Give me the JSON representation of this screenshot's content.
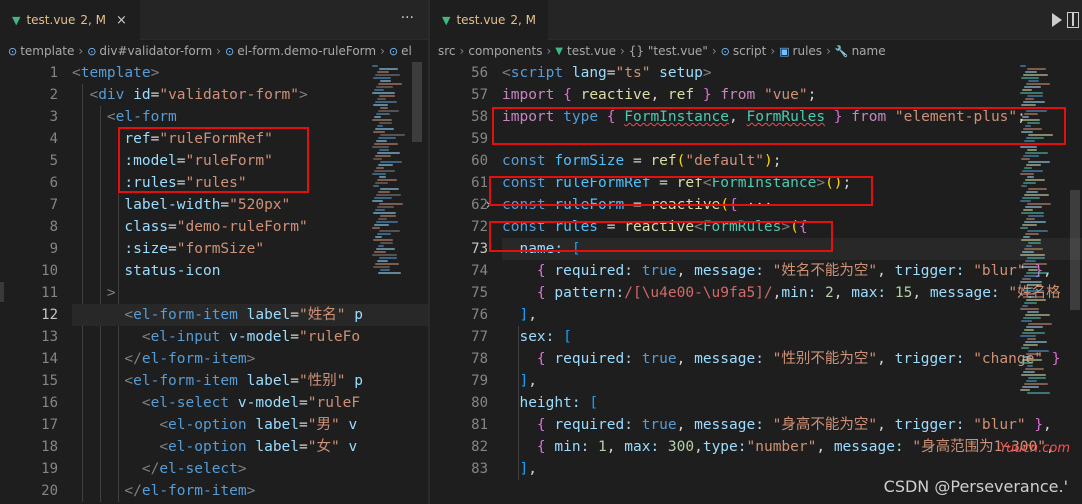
{
  "colors": {
    "vue": "#41b883",
    "modified": "#e2c08d",
    "highlight_box": "#e41010",
    "background": "#1e1e1e"
  },
  "left_editor": {
    "tab": {
      "icon": "vue-icon",
      "filename": "test.vue",
      "status": "2, M",
      "close": "×"
    },
    "more_actions": "···",
    "breadcrumb": [
      "template",
      "div#validator-form",
      "el-form.demo-ruleForm",
      "el"
    ],
    "line_numbers": [
      "1",
      "2",
      "3",
      "4",
      "5",
      "6",
      "7",
      "8",
      "9",
      "10",
      "11",
      "12",
      "13",
      "14",
      "15",
      "16",
      "17",
      "18",
      "19",
      "20"
    ],
    "active_line": "12",
    "lines": [
      "<template>",
      "  <div id=\"validator-form\">",
      "    <el-form",
      "      ref=\"ruleFormRef\"",
      "      :model=\"ruleForm\"",
      "      :rules=\"rules\"",
      "      label-width=\"520px\"",
      "      class=\"demo-ruleForm\"",
      "      :size=\"formSize\"",
      "      status-icon",
      "    >",
      "      <el-form-item label=\"姓名\" p",
      "        <el-input v-model=\"ruleFo",
      "      </el-form-item>",
      "      <el-form-item label=\"性别\" p",
      "        <el-select v-model=\"ruleF",
      "          <el-option label=\"男\" v",
      "          <el-option label=\"女\" v",
      "        </el-select>",
      "      </el-form-item>"
    ]
  },
  "right_editor": {
    "tab": {
      "icon": "vue-icon",
      "filename": "test.vue",
      "status": "2, M"
    },
    "run_button": "run-icon",
    "breadcrumb": [
      "src",
      "components",
      "test.vue",
      "{} \"test.vue\"",
      "script",
      "rules",
      "name"
    ],
    "line_numbers": [
      "56",
      "57",
      "58",
      "59",
      "60",
      "61",
      "62",
      "72",
      "73",
      "74",
      "75",
      "76",
      "77",
      "78",
      "79",
      "80",
      "81",
      "82",
      "83"
    ],
    "active_line": "73",
    "lines": [
      "<script lang=\"ts\" setup>",
      "import { reactive, ref } from \"vue\";",
      "import type { FormInstance, FormRules } from \"element-plus\";",
      "",
      "const formSize = ref(\"default\");",
      "const ruleFormRef = ref<FormInstance>();",
      "const ruleForm = reactive({ ···",
      "const rules = reactive<FormRules>({",
      "  name: [",
      "    { required: true, message: \"姓名不能为空\", trigger: \"blur\" },",
      "    { pattern:/[\\u4e00-\\u9fa5]/,min: 2, max: 15, message: \"姓名格",
      "  ],",
      "  sex: [",
      "    { required: true, message: \"性别不能为空\", trigger: \"change\" }",
      "  ],",
      "  height: [",
      "    { required: true, message: \"身高不能为空\", trigger: \"blur\" },",
      "    { min: 1, max: 300,type:\"number\", message: \"身高范围为1~300\",",
      "  ],"
    ]
  },
  "watermark": "CSDN @Perseverance.'",
  "watermark_site": "Yuucn.com"
}
